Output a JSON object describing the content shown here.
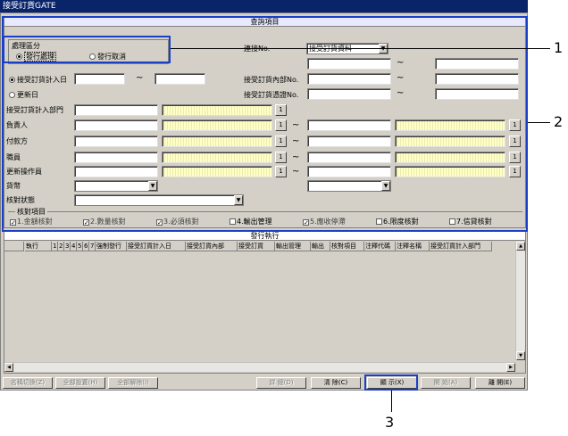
{
  "window": {
    "title": "接受訂貨GATE"
  },
  "search": {
    "header": "查詢項目",
    "process_group": {
      "label": "處理區分",
      "opt1": "發行處理",
      "opt2": "發行取消"
    },
    "link_label": "連接No.",
    "link_value": "接受訂貨資料",
    "radio_date": "接受訂貨計入日",
    "radio_update": "更新日",
    "internal_no": "接受訂貨內部No.",
    "slip_no": "接受訂貨憑證No.",
    "dept": "接受訂貨計入部門",
    "person": "負責人",
    "payer": "付款方",
    "staff": "職員",
    "updater": "更新操作員",
    "currency": "貨幣",
    "check_status": "核對狀態",
    "check_items": {
      "title": "核對項目",
      "items": [
        "1.金額核對",
        "2.數量核對",
        "3.必須核對",
        "4.輸出管理",
        "5.應收停滯",
        "6.限度核對",
        "7.信貸核對"
      ],
      "checked": [
        true,
        true,
        true,
        false,
        true,
        false,
        false
      ]
    },
    "tilde": "~",
    "lookup": "1"
  },
  "results": {
    "header": "發行執行",
    "columns": [
      "執行",
      "1",
      "2",
      "3",
      "4",
      "5",
      "6",
      "7",
      "強制發行",
      "接受訂貨計入日",
      "接受訂貨內部",
      "接受訂貨",
      "輸出管理",
      "輸出",
      "核對項目",
      "注釋代碼",
      "注釋名稱",
      "接受訂貨計入部門"
    ]
  },
  "buttons": {
    "name_switch": "名稱切換(Z)",
    "set_all": "全部設置(H)",
    "clear_all": "全部解除(I)",
    "detail": "詳 細(D)",
    "clear": "清 除(C)",
    "display": "顯 示(X)",
    "start": "開 始(A)",
    "close": "離 開(E)"
  },
  "callouts": {
    "c1": "1",
    "c2": "2",
    "c3": "3"
  }
}
